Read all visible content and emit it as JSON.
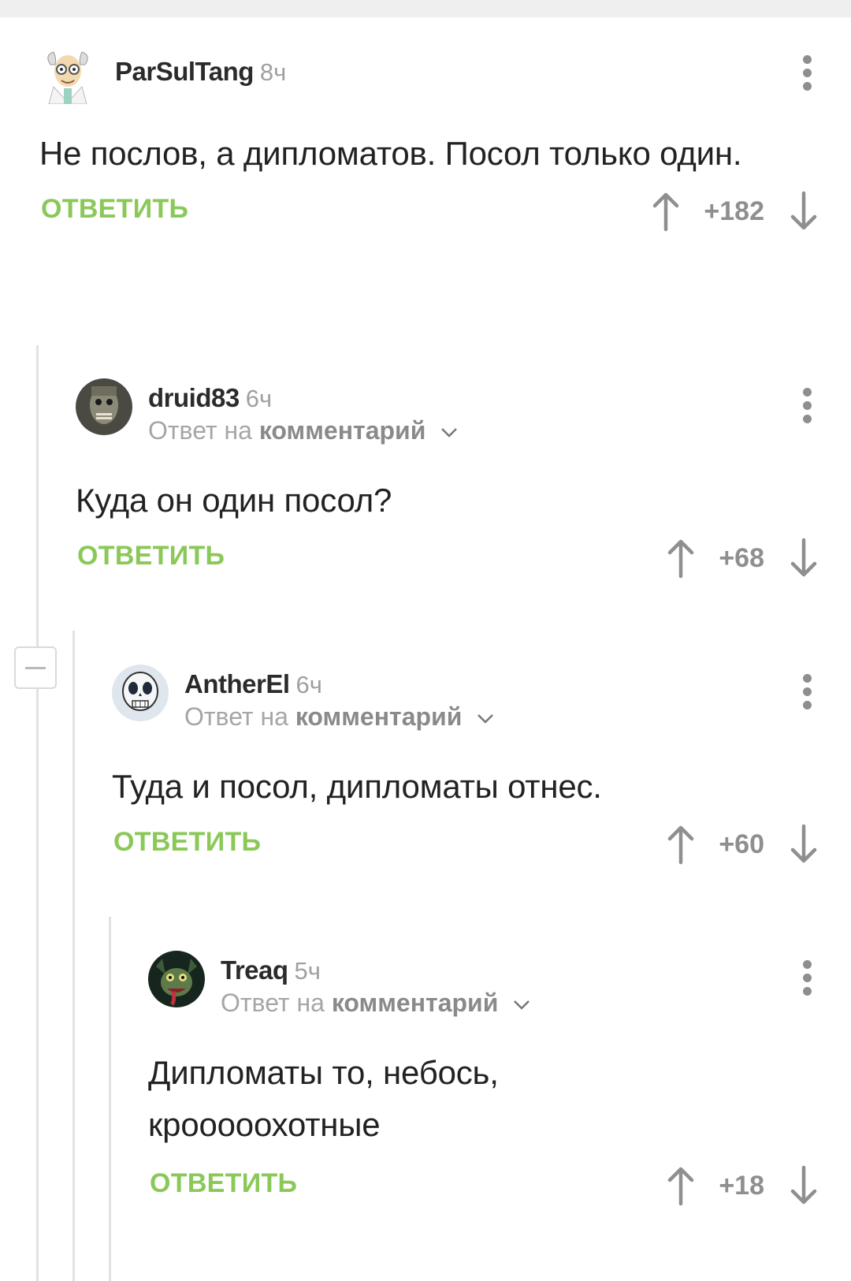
{
  "comments": [
    {
      "username": "ParSulTang",
      "time": "8ч",
      "reply_to_prefix": "",
      "reply_to_link": "",
      "text": "Не послов, а дипломатов. Посол только один.",
      "reply_label": "ОТВЕТИТЬ",
      "score": "+182",
      "avatar_icon": "avatar-scientist-icon"
    },
    {
      "username": "druid83",
      "time": "6ч",
      "reply_to_prefix": "Ответ на ",
      "reply_to_link": "комментарий",
      "text": "Куда он один посол?",
      "reply_label": "ОТВЕТИТЬ",
      "score": "+68",
      "avatar_icon": "avatar-monster-icon"
    },
    {
      "username": "AntherEl",
      "time": "6ч",
      "reply_to_prefix": "Ответ на ",
      "reply_to_link": "комментарий",
      "text": "Туда и посол, дипломаты отнес.",
      "reply_label": "ОТВЕТИТЬ",
      "score": "+60",
      "avatar_icon": "avatar-skull-icon"
    },
    {
      "username": "Treaq",
      "time": "5ч",
      "reply_to_prefix": "Ответ на ",
      "reply_to_link": "комментарий",
      "text": "Дипломаты то, небось, крооооохотные",
      "reply_label": "ОТВЕТИТЬ",
      "score": "+18",
      "avatar_icon": "avatar-creature-icon"
    }
  ],
  "colors": {
    "accent": "#8ac858",
    "muted": "#a6a6a6",
    "thread_line": "#e2e2e2"
  }
}
